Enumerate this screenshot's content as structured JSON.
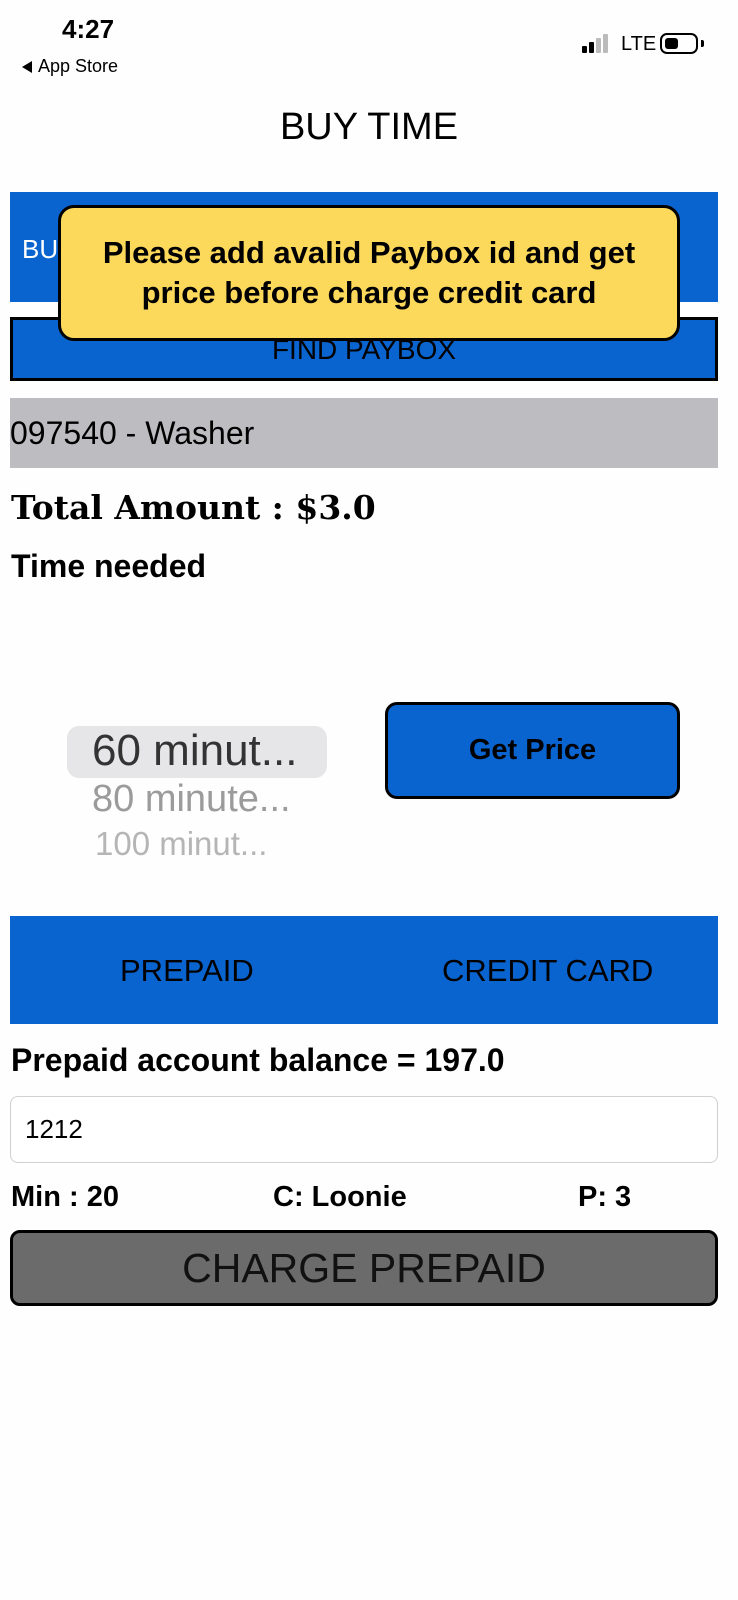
{
  "status_bar": {
    "time": "4:27",
    "back_label": "App Store",
    "network": "LTE"
  },
  "header": {
    "title": "BUY TIME"
  },
  "top_tabs": {
    "partial_label": "BU"
  },
  "find_paybox": {
    "label": "FIND PAYBOX"
  },
  "toast": {
    "message": "Please add avalid Paybox id and get price before charge credit card"
  },
  "paybox": {
    "selected": "097540 - Washer"
  },
  "total": {
    "label": "Total Amount : $3.0"
  },
  "time_needed": {
    "label": "Time needed"
  },
  "time_picker": {
    "options": [
      "60 minut...",
      "80 minute...",
      "100 minut..."
    ],
    "selected_index": 0
  },
  "get_price": {
    "label": "Get Price"
  },
  "payment_tabs": {
    "prepaid": "PREPAID",
    "credit_card": "CREDIT CARD"
  },
  "prepaid": {
    "balance_label": "Prepaid account balance = 197.0",
    "code_value": "1212",
    "min_label": "Min : 20",
    "coin_label": "C: Loonie",
    "p_label": "P: 3",
    "charge_label": "CHARGE PREPAID"
  },
  "colors": {
    "primary_blue": "#0a64cf",
    "toast_yellow": "#fcd95b",
    "paybox_gray": "#bdbdc1",
    "charge_gray": "#6b6b6b"
  }
}
